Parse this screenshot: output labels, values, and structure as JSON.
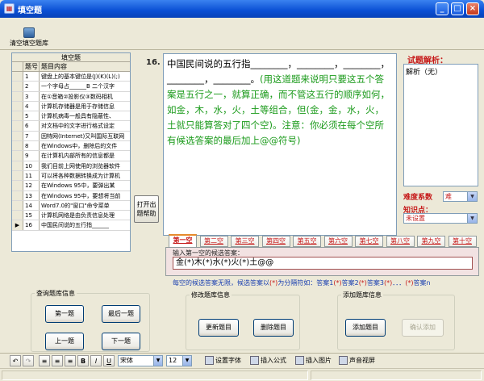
{
  "window": {
    "title": "填空题",
    "icon": "form-icon",
    "min_label": "_",
    "max_label": "□",
    "close_label": "×"
  },
  "toolbar": {
    "clear_label": "清空填空题库",
    "clear_icon": "database-icon"
  },
  "question_list": {
    "caption": "填空题",
    "col_num": "题号",
    "col_content": "题目内容",
    "rows": [
      {
        "num": "1",
        "text": "键盘上的基本键位是(J)(K)(L)(;)"
      },
      {
        "num": "2",
        "text": "一个字母占______B 二个汉字"
      },
      {
        "num": "3",
        "text": "在①音箱②投影仪③数码相机"
      },
      {
        "num": "4",
        "text": "计算机存储器是用于存储信息"
      },
      {
        "num": "5",
        "text": "计算机病毒一般具有隐蔽性、"
      },
      {
        "num": "6",
        "text": "对文档中的文字进行格式设定"
      },
      {
        "num": "7",
        "text": "因特网(Internet)又叫国际互联网"
      },
      {
        "num": "8",
        "text": "在Windows中，删除后的文件"
      },
      {
        "num": "9",
        "text": "在计算机内部所有的信息都是"
      },
      {
        "num": "10",
        "text": "我们目前上网使用的浏览器软件"
      },
      {
        "num": "11",
        "text": "可以将各种数据转换成为计算机"
      },
      {
        "num": "12",
        "text": "在Windows 95中，要弹出某"
      },
      {
        "num": "13",
        "text": "在Windows 95中，要想将当前"
      },
      {
        "num": "14",
        "text": "Word7.0的\"窗口\"命令菜单"
      },
      {
        "num": "15",
        "text": "计算机网络是由负责信息处理"
      },
      {
        "num": "16",
        "text": "中国民间说的五行指______"
      }
    ],
    "current_marker": "▶",
    "current_index": 15
  },
  "question": {
    "number": "16.",
    "stem": "中国民间说的五行指________，________，________，________，________。",
    "note": "(用这道题来说明只要这五个答案是五行之一，就算正确，而不管这五行的顺序如何，如金，木，水，火，土等组合，但(金，金，水，火，土就只能算答对了四个空)。注意：你必须在每个空所有候选答案的最后加上@@符号)"
  },
  "help_button": {
    "line1": "打开出",
    "line2": "题帮助"
  },
  "analysis": {
    "label": "试题解析：",
    "content": "解析（无）"
  },
  "difficulty": {
    "label": "难度系数",
    "value": "难",
    "arrow": "▼"
  },
  "knowledge": {
    "label": "知识点：",
    "value": "未设置",
    "arrow": "▼"
  },
  "blanks": {
    "tabs": [
      "第一空",
      "第二空",
      "第三空",
      "第四空",
      "第五空",
      "第六空",
      "第七空",
      "第八空",
      "第九空",
      "第十空"
    ],
    "active": 0,
    "prompt": "输入第一空的候选答案：",
    "value": "金(*)木(*)水(*)火(*)土@@"
  },
  "hint": {
    "text1": "每空的候选答案无限，候选答案以",
    "sep1": "(*)",
    "text2": "为分隔符如：答案1",
    "sep2": "(*)",
    "text3": "答案2",
    "sep3": "(*)",
    "text4": "答案3",
    "sep4": "(*)",
    "text5": "．．．",
    "sep5": "(*)",
    "text6": "答案n"
  },
  "query_group": {
    "legend": "查询题库信息",
    "first": "第一题",
    "last": "最后一题",
    "prev": "上一题",
    "next": "下一题"
  },
  "modify_group": {
    "legend": "修改题库信息",
    "update": "更新题目",
    "delete": "删除题目"
  },
  "add_group": {
    "legend": "添加题库信息",
    "add": "添加题目",
    "confirm": "确认添加"
  },
  "format_bar": {
    "undo": "↶",
    "redo": "↷",
    "align_left": "≡",
    "align_center": "≡",
    "align_right": "≡",
    "bold": "B",
    "italic": "I",
    "underline": "U",
    "font": "宋体",
    "size": "12",
    "arrow": "▼",
    "set_font": "设置字体",
    "insert_formula": "插入公式",
    "insert_image": "插入图片",
    "voice": "声音视屏"
  }
}
